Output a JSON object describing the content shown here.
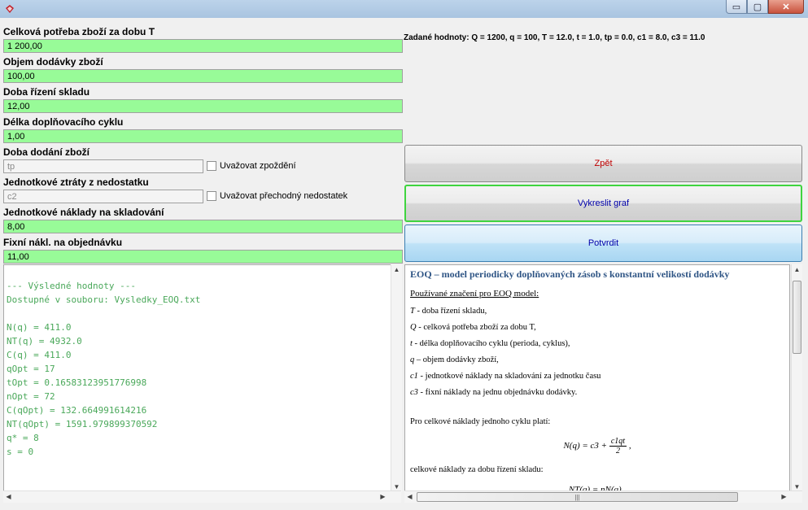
{
  "window": {
    "minimize": "▭",
    "restore": "▢",
    "close": "✕"
  },
  "fields": {
    "total_demand": {
      "label": "Celková potřeba zboží za dobu T",
      "value": "1 200,00"
    },
    "delivery_volume": {
      "label": "Objem dodávky zboží",
      "value": "100,00"
    },
    "management_time": {
      "label": "Doba řízení skladu",
      "value": "12,00"
    },
    "cycle_length": {
      "label": "Délka doplňovacího cyklu",
      "value": "1,00"
    },
    "lead_time": {
      "label": "Doba dodání zboží",
      "placeholder": "tp",
      "checkbox": "Uvažovat zpoždění"
    },
    "shortage_cost": {
      "label": "Jednotkové ztráty z nedostatku",
      "placeholder": "c2",
      "checkbox": "Uvažovat přechodný nedostatek"
    },
    "holding_cost": {
      "label": "Jednotkové náklady na skladování",
      "value": "8,00"
    },
    "order_cost": {
      "label": "Fixní nákl. na objednávku",
      "value": "11,00"
    }
  },
  "params_text": "Zadané hodnoty: Q = 1200, q = 100, T = 12.0, t = 1.0, tp = 0.0, c1 = 8.0, c3 = 11.0",
  "buttons": {
    "back": "Zpět",
    "plot": "Vykreslit graf",
    "confirm": "Potvrdit"
  },
  "output_lines": [
    "",
    "--- Výsledné hodnoty ---",
    "Dostupné v souboru: Vysledky_EOQ.txt",
    "",
    "N(q) = 411.0",
    "NT(q) = 4932.0",
    "C(q) = 411.0",
    "qOpt = 17",
    "tOpt = 0.16583123951776998",
    "nOpt = 72",
    "C(qOpt) = 132.664991614216",
    "NT(qOpt) = 1591.979899370592",
    "q* = 8",
    "s = 0"
  ],
  "doc": {
    "title": "EOQ – model periodicky doplňovaných zásob s konstantní velikostí dodávky",
    "subtitle": "Používané značení pro EOQ model:",
    "lines": [
      {
        "sym": "T",
        "text": " - doba řízení skladu,"
      },
      {
        "sym": "Q",
        "text": " - celková potřeba zboží za dobu T,"
      },
      {
        "sym": "t",
        "text": " - délka doplňovacího cyklu (perioda, cyklus),"
      },
      {
        "sym": "q",
        "text": " – objem dodávky zboží,"
      },
      {
        "sym": "c1",
        "text": " - jednotkové náklady na skladování za jednotku času"
      },
      {
        "sym": "c3",
        "text": " - fixní náklady na jednu objednávku dodávky."
      }
    ],
    "para1": "Pro celkové náklady jednoho cyklu platí:",
    "formula1_left": "N(q) = c3 +",
    "formula1_num": "c1qt",
    "formula1_den": "2",
    "formula1_end": ",",
    "para2": "celkové náklady za dobu řízení skladu:",
    "formula2": "NT(q) = nN(q) ,"
  },
  "scroll": {
    "up": "▲",
    "down": "▼",
    "left": "◀",
    "right": "▶",
    "grip": "|||"
  }
}
